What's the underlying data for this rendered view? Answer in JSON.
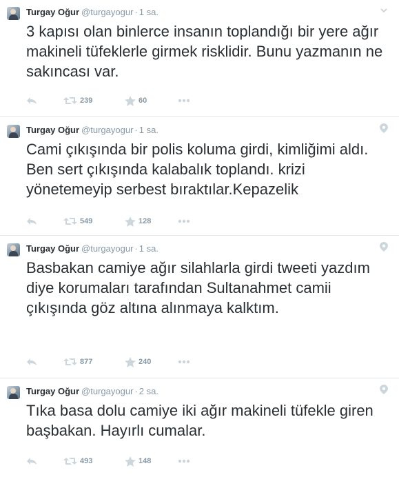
{
  "tweets": [
    {
      "name": "Turgay Oğur",
      "handle": "@turgayogur",
      "time": "1 sa.",
      "text": "3 kapısı olan binlerce insanın toplandığı bir yere ağır makineli tüfeklerle girmek risklidir. Bunu yazmanın ne sakıncası var.",
      "retweets": "239",
      "favorites": "60",
      "corner_icon": "chevron-down-icon"
    },
    {
      "name": "Turgay Oğur",
      "handle": "@turgayogur",
      "time": "1 sa.",
      "text": "Cami çıkışında bir polis koluma girdi, kimliğimi aldı. Ben sert çıkışında kalabalık toplandı. krizi yönetemeyip serbest bıraktılar.Kepazelik",
      "retweets": "549",
      "favorites": "128",
      "corner_icon": "location-pin-icon"
    },
    {
      "name": "Turgay Oğur",
      "handle": "@turgayogur",
      "time": "1 sa.",
      "text": "Basbakan camiye ağır silahlarla girdi tweeti yazdım diye korumaları tarafından Sultanahmet camii çıkışında göz altına alınmaya kalktım.",
      "retweets": "877",
      "favorites": "240",
      "corner_icon": "location-pin-icon"
    },
    {
      "name": "Turgay Oğur",
      "handle": "@turgayogur",
      "time": "2 sa.",
      "text": "Tıka basa dolu camiye iki ağır makineli tüfekle giren başbakan. Hayırlı cumalar.",
      "retweets": "493",
      "favorites": "148",
      "corner_icon": "location-pin-icon"
    }
  ],
  "colors": {
    "text": "#292f33",
    "muted": "#8899a6",
    "icon": "#ccd6dd",
    "border": "#e1e8ed"
  }
}
